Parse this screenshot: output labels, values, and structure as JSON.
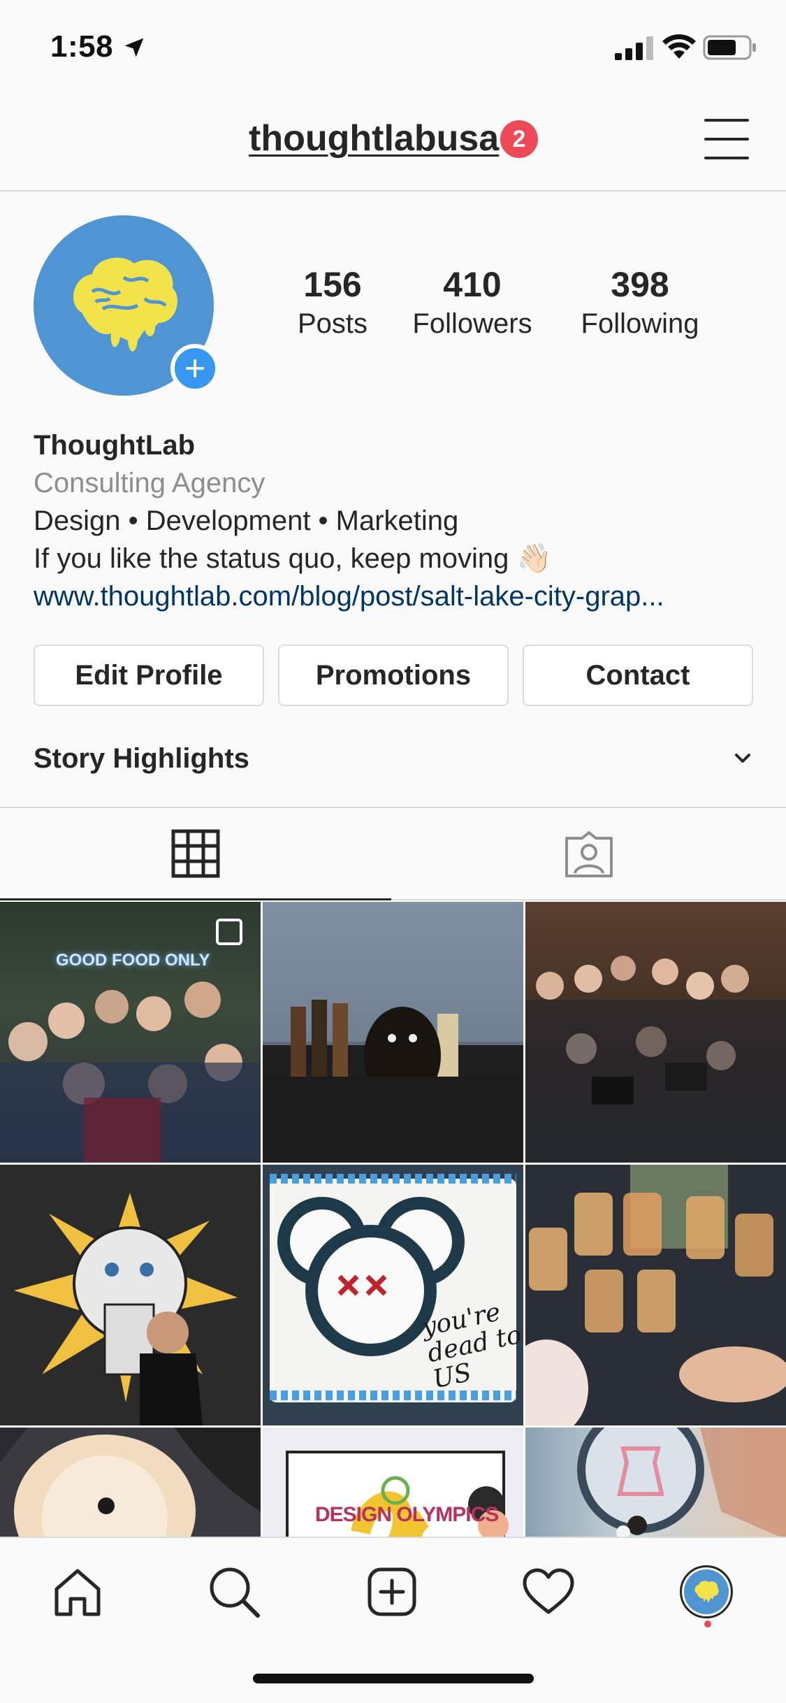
{
  "status_bar": {
    "time": "1:58"
  },
  "header": {
    "username": "thoughtlabusa",
    "notification_count": "2"
  },
  "profile": {
    "stats": [
      {
        "value": "156",
        "label": "Posts"
      },
      {
        "value": "410",
        "label": "Followers"
      },
      {
        "value": "398",
        "label": "Following"
      }
    ],
    "name": "ThoughtLab",
    "category": "Consulting Agency",
    "bio_line1": "Design • Development • Marketing",
    "bio_line2": "If you like the status quo, keep moving 👋🏻",
    "website": "www.thoughtlab.com/blog/post/salt-lake-city-grap..."
  },
  "buttons": {
    "edit_profile": "Edit Profile",
    "promotions": "Promotions",
    "contact": "Contact"
  },
  "story_highlights": {
    "title": "Story Highlights"
  },
  "posts": [
    {
      "text": "GOOD FOOD ONLY",
      "icon": "multi-photo-icon"
    },
    {
      "text": ""
    },
    {
      "text": ""
    },
    {
      "text": ""
    },
    {
      "text": "you're dead to US"
    },
    {
      "text": ""
    },
    {
      "text": ""
    },
    {
      "text": "DESIGN OLYMPICS"
    },
    {
      "text": ""
    }
  ],
  "colors": {
    "accent": "#3897f0",
    "badge": "#ed4956",
    "link": "#003569",
    "brand_blue": "#4f95d4",
    "brand_yellow": "#f2e34a"
  }
}
